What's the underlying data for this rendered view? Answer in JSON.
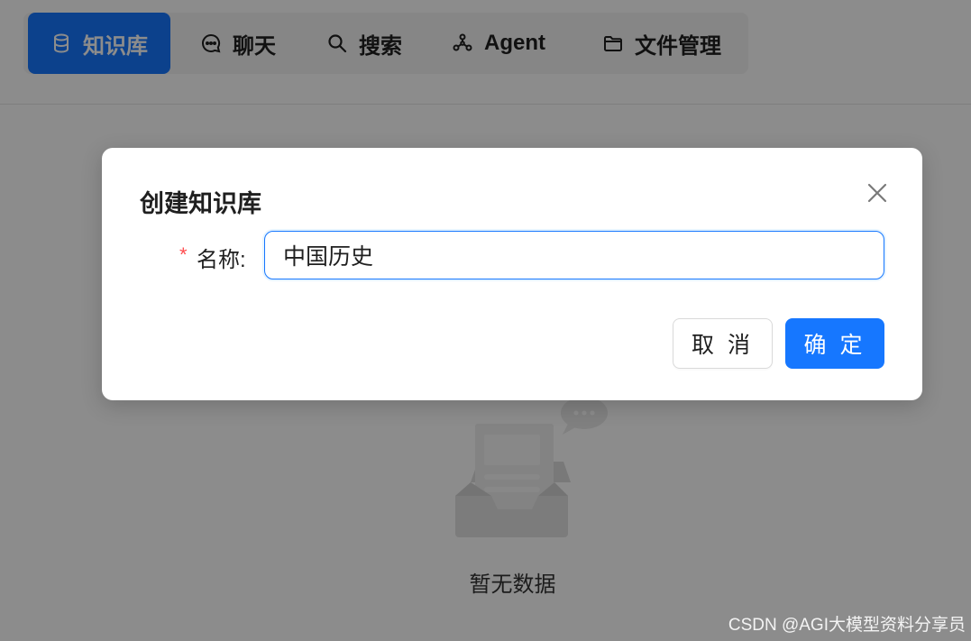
{
  "nav": {
    "items": [
      {
        "label": "知识库",
        "icon": "database-icon",
        "active": true
      },
      {
        "label": "聊天",
        "icon": "chat-bubble-icon",
        "active": false
      },
      {
        "label": "搜索",
        "icon": "search-icon",
        "active": false
      },
      {
        "label": "Agent",
        "icon": "nodes-icon",
        "active": false
      },
      {
        "label": "文件管理",
        "icon": "folder-icon",
        "active": false
      }
    ]
  },
  "empty_state": {
    "text": "暂无数据",
    "icon": "empty-inbox-icon"
  },
  "modal": {
    "title": "创建知识库",
    "close_icon": "close-icon",
    "form": {
      "required_mark": "*",
      "name_label": "名称:",
      "name_value": "中国历史"
    },
    "buttons": {
      "cancel": "取 消",
      "ok": "确 定"
    }
  },
  "watermark": "CSDN @AGI大模型资料分享员",
  "colors": {
    "primary": "#1677ff",
    "required": "#ff4d4f",
    "overlay": "rgba(0,0,0,0.45)"
  }
}
